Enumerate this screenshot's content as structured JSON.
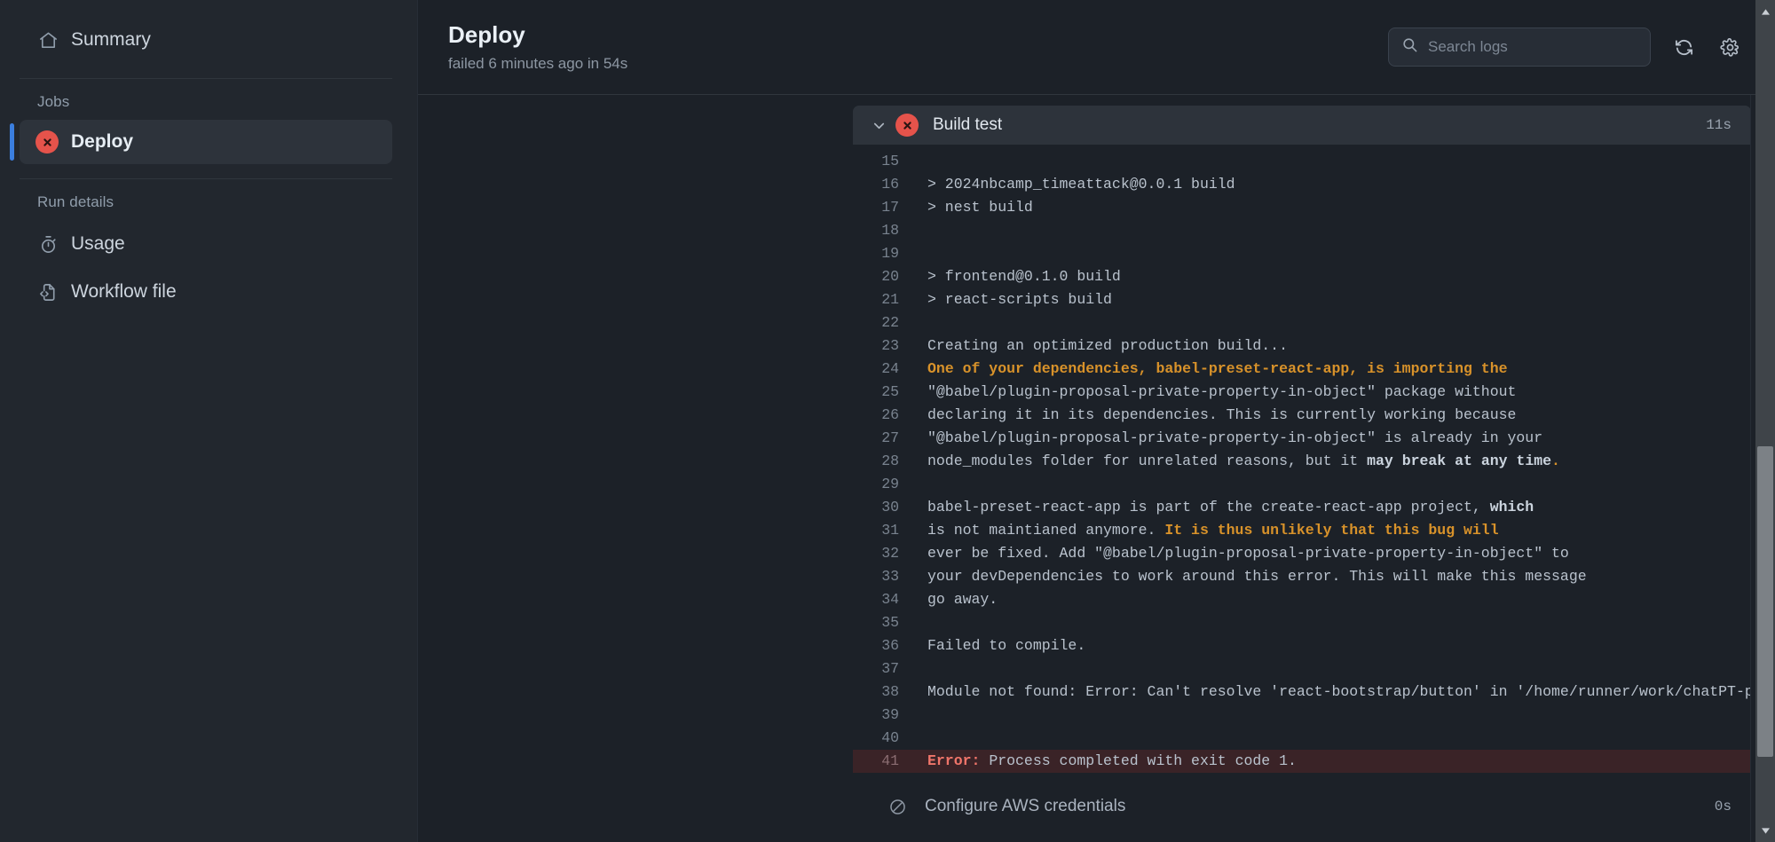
{
  "sidebar": {
    "summary": {
      "label": "Summary",
      "icon": "home-icon"
    },
    "jobs_heading": "Jobs",
    "jobs": [
      {
        "label": "Deploy",
        "status": "failed",
        "icon": "failure-x-circle-icon",
        "selected": true
      }
    ],
    "run_details_heading": "Run details",
    "run_details": [
      {
        "label": "Usage",
        "icon": "stopwatch-icon"
      },
      {
        "label": "Workflow file",
        "icon": "file-code-icon"
      }
    ]
  },
  "header": {
    "title": "Deploy",
    "subtitle": "failed 6 minutes ago in 54s",
    "search": {
      "placeholder": "Search logs",
      "value": "",
      "icon": "search-icon"
    },
    "refresh_icon": "refresh-icon",
    "settings_icon": "gear-icon"
  },
  "step": {
    "name": "Build test",
    "status": "failure",
    "status_icon": "failure-x-circle-icon",
    "chevron_icon": "chevron-down-icon",
    "duration": "11s",
    "expanded": true
  },
  "next_step": {
    "name": "Configure AWS credentials",
    "status": "skipped",
    "status_icon": "skip-circle-slash-icon",
    "duration": "0s"
  },
  "colors": {
    "page_bg": "#1c2128",
    "sidebar_bg": "#22272e",
    "selected_bg": "#2d333b",
    "accent_blue": "#3b7ede",
    "failure_red": "#e5534b",
    "warning_orange": "#d8922a",
    "error_text": "#f0756a",
    "error_row_bg": "#3a2327",
    "text_primary": "#c9d1d9",
    "text_muted": "#8d97a3"
  },
  "log": {
    "lines": [
      {
        "n": "15",
        "parts": []
      },
      {
        "n": "16",
        "parts": [
          {
            "t": "> 2024nbcamp_timeattack@0.0.1 build",
            "s": "plain"
          }
        ]
      },
      {
        "n": "17",
        "parts": [
          {
            "t": "> nest build",
            "s": "plain"
          }
        ]
      },
      {
        "n": "18",
        "parts": []
      },
      {
        "n": "19",
        "parts": []
      },
      {
        "n": "20",
        "parts": [
          {
            "t": "> frontend@0.1.0 build",
            "s": "plain"
          }
        ]
      },
      {
        "n": "21",
        "parts": [
          {
            "t": "> react-scripts build",
            "s": "plain"
          }
        ]
      },
      {
        "n": "22",
        "parts": []
      },
      {
        "n": "23",
        "parts": [
          {
            "t": "Creating an optimized production build...",
            "s": "plain"
          }
        ]
      },
      {
        "n": "24",
        "parts": [
          {
            "t": "One of your dependencies, babel-preset-react-app, is importing the",
            "s": "warn"
          }
        ]
      },
      {
        "n": "25",
        "parts": [
          {
            "t": "\"@babel/plugin-proposal-private-property-in-object\" package without",
            "s": "plain"
          }
        ]
      },
      {
        "n": "26",
        "parts": [
          {
            "t": "declaring it in its dependencies. This is currently working because",
            "s": "plain"
          }
        ]
      },
      {
        "n": "27",
        "parts": [
          {
            "t": "\"@babel/plugin-proposal-private-property-in-object\" is already in your",
            "s": "plain"
          }
        ]
      },
      {
        "n": "28",
        "parts": [
          {
            "t": "node_modules folder for unrelated reasons, but it ",
            "s": "plain"
          },
          {
            "t": "may break at any time",
            "s": "bold"
          },
          {
            "t": ".",
            "s": "warn"
          }
        ]
      },
      {
        "n": "29",
        "parts": []
      },
      {
        "n": "30",
        "parts": [
          {
            "t": "babel-preset-react-app is part of the create-react-app project, ",
            "s": "plain"
          },
          {
            "t": "which",
            "s": "bold"
          }
        ]
      },
      {
        "n": "31",
        "parts": [
          {
            "t": "is not maintianed anymore. ",
            "s": "plain"
          },
          {
            "t": "It is thus unlikely that this bug will",
            "s": "warn"
          }
        ]
      },
      {
        "n": "32",
        "parts": [
          {
            "t": "ever be fixed. Add \"@babel/plugin-proposal-private-property-in-object\" to",
            "s": "plain"
          }
        ]
      },
      {
        "n": "33",
        "parts": [
          {
            "t": "your devDependencies to work around this error. This will make this message",
            "s": "plain"
          }
        ]
      },
      {
        "n": "34",
        "parts": [
          {
            "t": "go away.",
            "s": "plain"
          }
        ]
      },
      {
        "n": "35",
        "parts": []
      },
      {
        "n": "36",
        "parts": [
          {
            "t": "Failed to compile.",
            "s": "plain"
          }
        ]
      },
      {
        "n": "37",
        "parts": []
      },
      {
        "n": "38",
        "parts": [
          {
            "t": "Module not found: Error: Can't resolve 'react-bootstrap/button' in '/home/runner/work/chatPT-project/chatPT-project/frontend/src/components/payment'",
            "s": "plain"
          }
        ]
      },
      {
        "n": "39",
        "parts": []
      },
      {
        "n": "40",
        "parts": []
      },
      {
        "n": "41",
        "error_row": true,
        "parts": [
          {
            "t": "Error:",
            "s": "error"
          },
          {
            "t": " Process completed with exit code 1.",
            "s": "plain"
          }
        ]
      }
    ]
  }
}
